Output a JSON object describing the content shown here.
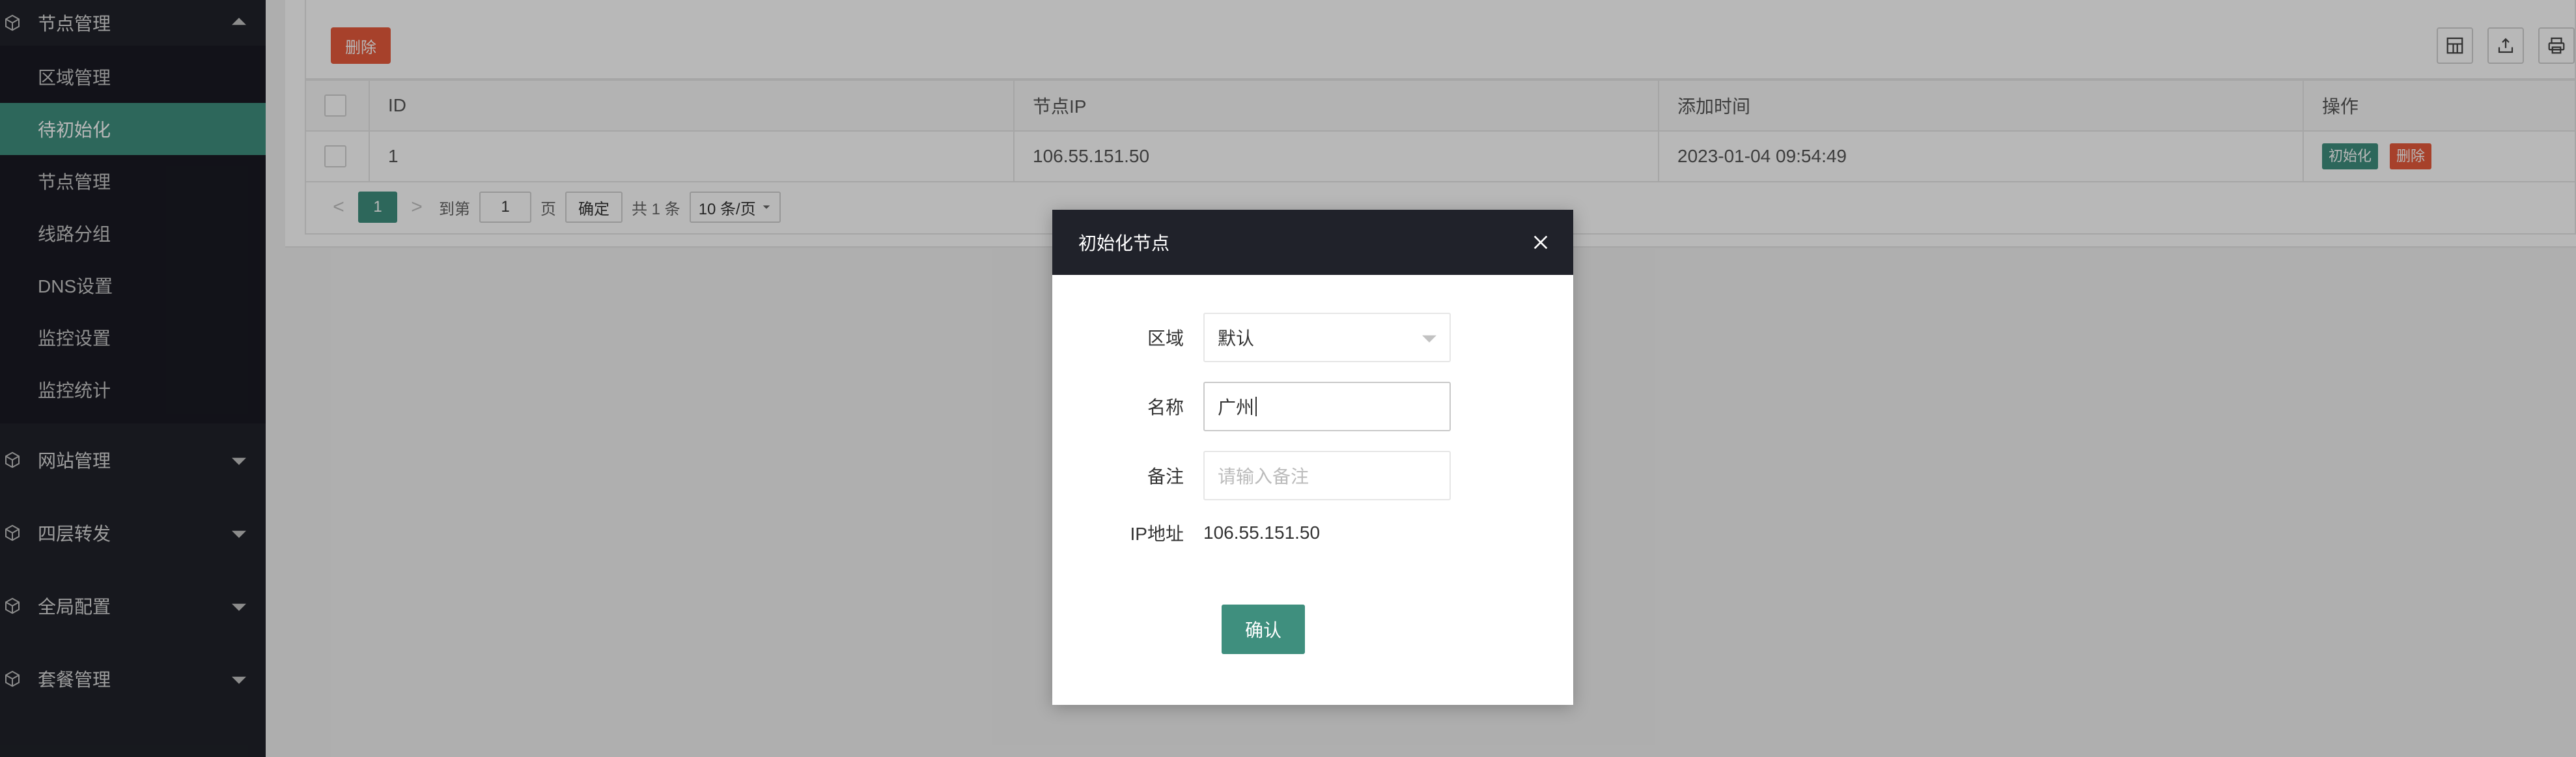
{
  "sidebar": {
    "top_group": {
      "label": "节点管理",
      "icon": "cube-icon",
      "expanded": true
    },
    "sub_items": [
      {
        "label": "区域管理",
        "active": false
      },
      {
        "label": "待初始化",
        "active": true
      },
      {
        "label": "节点管理",
        "active": false
      },
      {
        "label": "线路分组",
        "active": false
      },
      {
        "label": "DNS设置",
        "active": false
      },
      {
        "label": "监控设置",
        "active": false
      },
      {
        "label": "监控统计",
        "active": false,
        "has_caret": true
      }
    ],
    "groups": [
      {
        "label": "网站管理",
        "icon": "cube-icon"
      },
      {
        "label": "四层转发",
        "icon": "cube-icon"
      },
      {
        "label": "全局配置",
        "icon": "cube-icon"
      },
      {
        "label": "套餐管理",
        "icon": "cube-icon"
      }
    ]
  },
  "toolbar": {
    "delete_label": "删除",
    "icons": [
      "columns-icon",
      "export-icon",
      "print-icon"
    ]
  },
  "table": {
    "columns": [
      "ID",
      "节点IP",
      "添加时间",
      "操作"
    ],
    "rows": [
      {
        "id": "1",
        "ip": "106.55.151.50",
        "time": "2023-01-04 09:54:49",
        "actions": [
          "初始化",
          "删除"
        ]
      }
    ]
  },
  "pager": {
    "prev": "<",
    "current": "1",
    "next": ">",
    "goto_label": "到第",
    "goto_value": "1",
    "page_unit": "页",
    "confirm_label": "确定",
    "total_label": "共 1 条",
    "page_size": "10 条/页"
  },
  "dialog": {
    "title": "初始化节点",
    "fields": {
      "region_label": "区域",
      "region_value": "默认",
      "name_label": "名称",
      "name_value": "广州",
      "remark_label": "备注",
      "remark_placeholder": "请输入备注",
      "ip_label": "IP地址",
      "ip_value": "106.55.151.50"
    },
    "confirm_label": "确认"
  },
  "colors": {
    "sidebar_bg": "#20222a",
    "accent_green": "#3f8f7e",
    "danger_orange": "#e85a3c"
  }
}
